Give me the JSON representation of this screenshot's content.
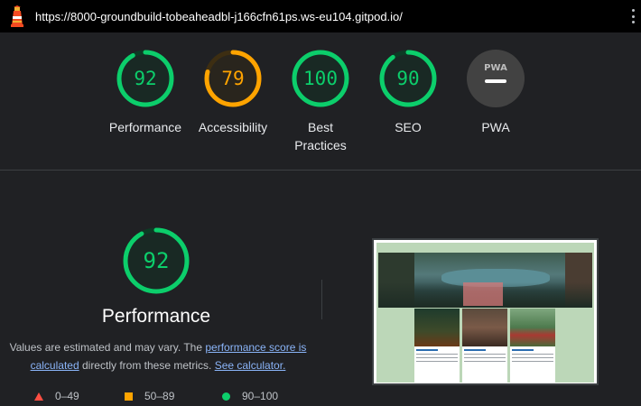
{
  "address_bar": {
    "url": "https://8000-groundbuild-tobeaheadbl-j166cfn61ps.ws-eu104.gitpod.io/"
  },
  "gauges": [
    {
      "label": "Performance",
      "score": "92",
      "fraction": 0.92,
      "color": "#0cce6b",
      "track": "#0d3a24"
    },
    {
      "label": "Accessibility",
      "score": "79",
      "fraction": 0.79,
      "color": "#ffa400",
      "track": "#3d2e12"
    },
    {
      "label": "Best Practices",
      "score": "100",
      "fraction": 1.0,
      "color": "#0cce6b",
      "track": "#0d3a24"
    },
    {
      "label": "SEO",
      "score": "90",
      "fraction": 0.9,
      "color": "#0cce6b",
      "track": "#0d3a24"
    },
    {
      "label": "PWA",
      "badge": "PWA",
      "color": "#9aa0a6"
    }
  ],
  "performance": {
    "score": "92",
    "fraction": 0.92,
    "title": "Performance",
    "desc_prefix": "Values are estimated and may vary. The ",
    "link_score": "performance score is calculated",
    "desc_middle": " directly from these metrics. ",
    "link_calc": "See calculator."
  },
  "legend": [
    {
      "shape": "triangle",
      "label": "0–49",
      "color": "#ff4e42"
    },
    {
      "shape": "square",
      "label": "50–89",
      "color": "#ffa400"
    },
    {
      "shape": "circle",
      "label": "90–100",
      "color": "#0cce6b"
    }
  ],
  "colors": {
    "pass": "#0cce6b",
    "average": "#ffa400",
    "fail": "#ff4e42",
    "link": "#8ab4f8",
    "background": "#202124"
  },
  "icons": {
    "logo": "lighthouse-icon",
    "menu": "kebab-menu-icon",
    "pwa": "pwa-badge-icon"
  }
}
